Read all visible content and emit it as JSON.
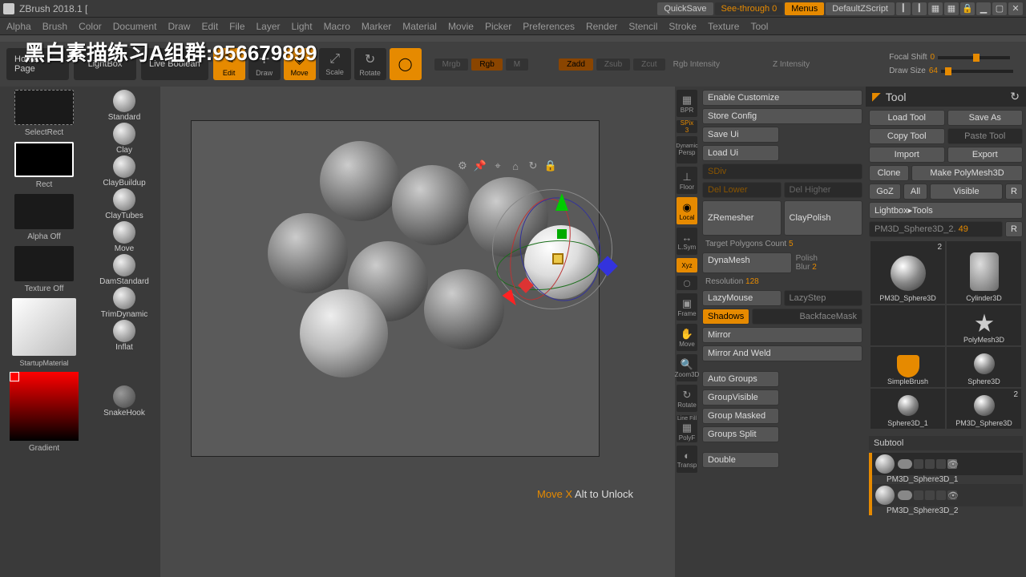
{
  "app": {
    "title": "ZBrush 2018.1 ["
  },
  "titlebar": {
    "quicksave": "QuickSave",
    "seethrough": "See-through",
    "seethrough_val": "0",
    "menus": "Menus",
    "default_script": "DefaultZScript"
  },
  "menu": [
    "Alpha",
    "Brush",
    "Color",
    "Document",
    "Draw",
    "Edit",
    "File",
    "Layer",
    "Light",
    "Macro",
    "Marker",
    "Material",
    "Movie",
    "Picker",
    "Preferences",
    "Render",
    "Stencil",
    "Stroke",
    "Texture",
    "Tool"
  ],
  "watermark": "黑白素描练习A组群:956679899",
  "toolbar": {
    "home": "Home Page",
    "lightbox": "LightBox",
    "livebool": "Live Boolean",
    "modes": {
      "edit": "Edit",
      "draw": "Draw",
      "move": "Move",
      "scale": "Scale",
      "rotate": "Rotate"
    },
    "mrgb": "Mrgb",
    "rgb": "Rgb",
    "m": "M",
    "zadd": "Zadd",
    "zsub": "Zsub",
    "zcut": "Zcut",
    "rgbint": "Rgb Intensity",
    "zint": "Z Intensity",
    "focal": "Focal Shift",
    "focal_val": "0",
    "drawsize": "Draw Size",
    "drawsize_val": "64"
  },
  "left": {
    "selectrect": "SelectRect",
    "rect": "Rect",
    "alphaoff": "Alpha Off",
    "textureoff": "Texture Off",
    "material": "StartupMaterial",
    "gradient": "Gradient"
  },
  "brushes": [
    "Standard",
    "Clay",
    "ClayBuildup",
    "ClayTubes",
    "Move",
    "DamStandard",
    "TrimDynamic",
    "Inflat",
    "",
    "SnakeHook"
  ],
  "canvas": {
    "hint_action": "Move X",
    "hint_rest": "Alt to Unlock"
  },
  "dock": {
    "bpr": "BPR",
    "spix": "SPix",
    "spix_val": "3",
    "dynamic": "Dynamic",
    "persp": "Persp",
    "floor": "Floor",
    "local": "Local",
    "lsym": "L.Sym",
    "xyz": "Xyz",
    "frame": "Frame",
    "move": "Move",
    "zoom": "Zoom3D",
    "rotate": "Rotate",
    "linefill": "Line Fill",
    "polyf": "PolyF",
    "transp": "Transp"
  },
  "settings": {
    "enable_custom": "Enable Customize",
    "store_config": "Store Config",
    "save_ui": "Save Ui",
    "load_ui": "Load Ui",
    "sdiv": "SDiv",
    "del_lower": "Del Lower",
    "del_higher": "Del Higher",
    "claypolish": "ClayPolish",
    "zremesher": "ZRemesher",
    "target_poly": "Target Polygons Count",
    "target_poly_val": "5",
    "dynamesh": "DynaMesh",
    "polish": "Polish",
    "blur": "Blur",
    "blur_val": "2",
    "resolution": "Resolution",
    "resolution_val": "128",
    "lazymouse": "LazyMouse",
    "lazystep": "LazyStep",
    "shadows": "Shadows",
    "backface": "BackfaceMask",
    "mirror": "Mirror",
    "mirror_weld": "Mirror And Weld",
    "autogroups": "Auto Groups",
    "groupvisible": "GroupVisible",
    "groupmasked": "Group Masked",
    "groupssplit": "Groups Split",
    "double": "Double"
  },
  "tool": {
    "title": "Tool",
    "load": "Load Tool",
    "saveas": "Save As",
    "copy": "Copy Tool",
    "paste": "Paste Tool",
    "import": "Import",
    "export": "Export",
    "clone": "Clone",
    "makepoly": "Make PolyMesh3D",
    "goz": "GoZ",
    "all": "All",
    "visible": "Visible",
    "r": "R",
    "lightbox_tools": "Lightbox▸Tools",
    "current": "PM3D_Sphere3D_2.",
    "current_val": "49",
    "thumbs": [
      {
        "label": "PM3D_Sphere3D",
        "count": "2",
        "shape": "ball"
      },
      {
        "label": "Cylinder3D",
        "count": "",
        "shape": "cyl"
      },
      {
        "label": "",
        "count": "",
        "shape": "none"
      },
      {
        "label": "PolyMesh3D",
        "count": "",
        "shape": "star"
      },
      {
        "label": "SimpleBrush",
        "count": "",
        "shape": "sbrush"
      },
      {
        "label": "Sphere3D",
        "count": "",
        "shape": "ball"
      },
      {
        "label": "Sphere3D_1",
        "count": "",
        "shape": "ball"
      },
      {
        "label": "PM3D_Sphere3D",
        "count": "2",
        "shape": "ball"
      }
    ],
    "subtool": "Subtool",
    "sub_items": [
      "PM3D_Sphere3D_1",
      "PM3D_Sphere3D_2"
    ]
  }
}
